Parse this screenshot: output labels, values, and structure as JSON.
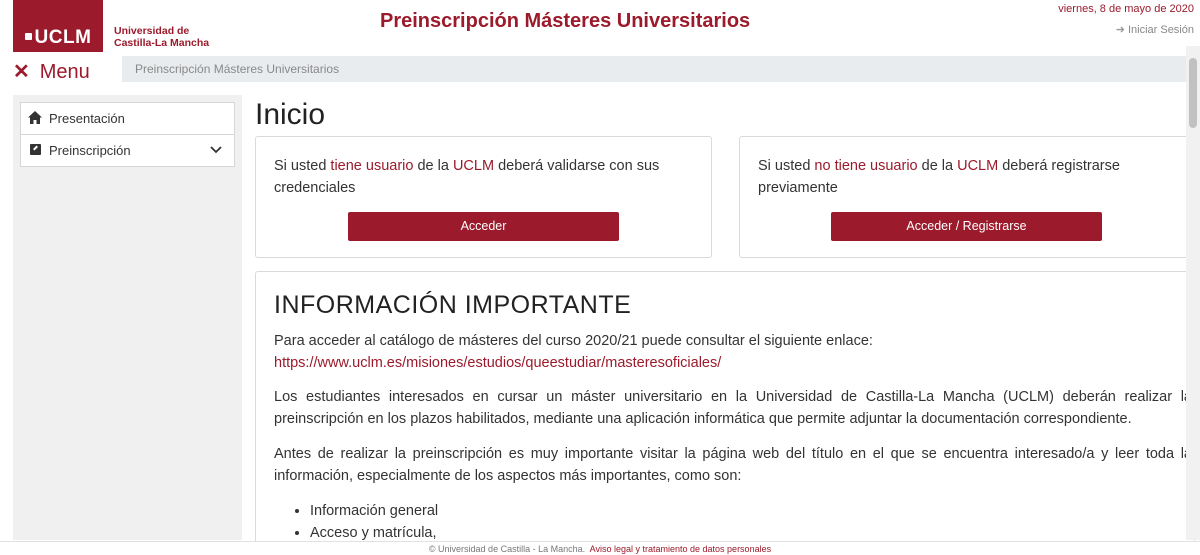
{
  "header": {
    "logo_text": "UCLM",
    "university_name_line1": "Universidad de",
    "university_name_line2": "Castilla-La Mancha",
    "site_title": "Preinscripción Másteres Universitarios",
    "date": "viernes, 8 de mayo de 2020",
    "login_label": "Iniciar Sesión"
  },
  "menu": {
    "label": "Menu"
  },
  "breadcrumb": {
    "current": "Preinscripción Másteres Universitarios"
  },
  "sidebar": {
    "items": [
      {
        "label": "Presentación",
        "icon": "home-icon"
      },
      {
        "label": "Preinscripción",
        "icon": "edit-icon"
      }
    ]
  },
  "main": {
    "title": "Inicio",
    "card_user": {
      "text_pre": "Si usted ",
      "text_highlight1": "tiene usuario",
      "text_mid": " de la ",
      "text_highlight2": "UCLM",
      "text_post": " deberá validarse con sus credenciales",
      "button_label": "Acceder"
    },
    "card_nouser": {
      "text_pre": "Si usted ",
      "text_highlight1": "no tiene usuario",
      "text_mid": " de la ",
      "text_highlight2": "UCLM",
      "text_post": " deberá registrarse previamente",
      "button_label": "Acceder / Registrarse"
    },
    "info": {
      "heading": "INFORMACIÓN IMPORTANTE",
      "para1": "Para acceder al catálogo de másteres del curso 2020/21 puede consultar el siguiente enlace:",
      "link": "https://www.uclm.es/misiones/estudios/queestudiar/masteresoficiales/",
      "para2": "Los estudiantes interesados en cursar un máster universitario en la Universidad de Castilla-La Mancha (UCLM) deberán realizar la preinscripción en los plazos habilitados, mediante una aplicación informática que permite adjuntar la documentación correspondiente.",
      "para3": "Antes de realizar la preinscripción es muy importante visitar la página web del título en el que se encuentra interesado/a y leer toda la información, especialmente de los aspectos más importantes, como son:",
      "list": [
        "Información general",
        "Acceso y matrícula,"
      ]
    }
  },
  "footer": {
    "copyright": "© Universidad de Castilla - La Mancha.",
    "legal_link": "Aviso legal y tratamiento de datos personales"
  },
  "colors": {
    "brand": "#9b1a2b",
    "breadcrumb_bg": "#e9ecef",
    "sidebar_bg": "#f0f0f0"
  }
}
